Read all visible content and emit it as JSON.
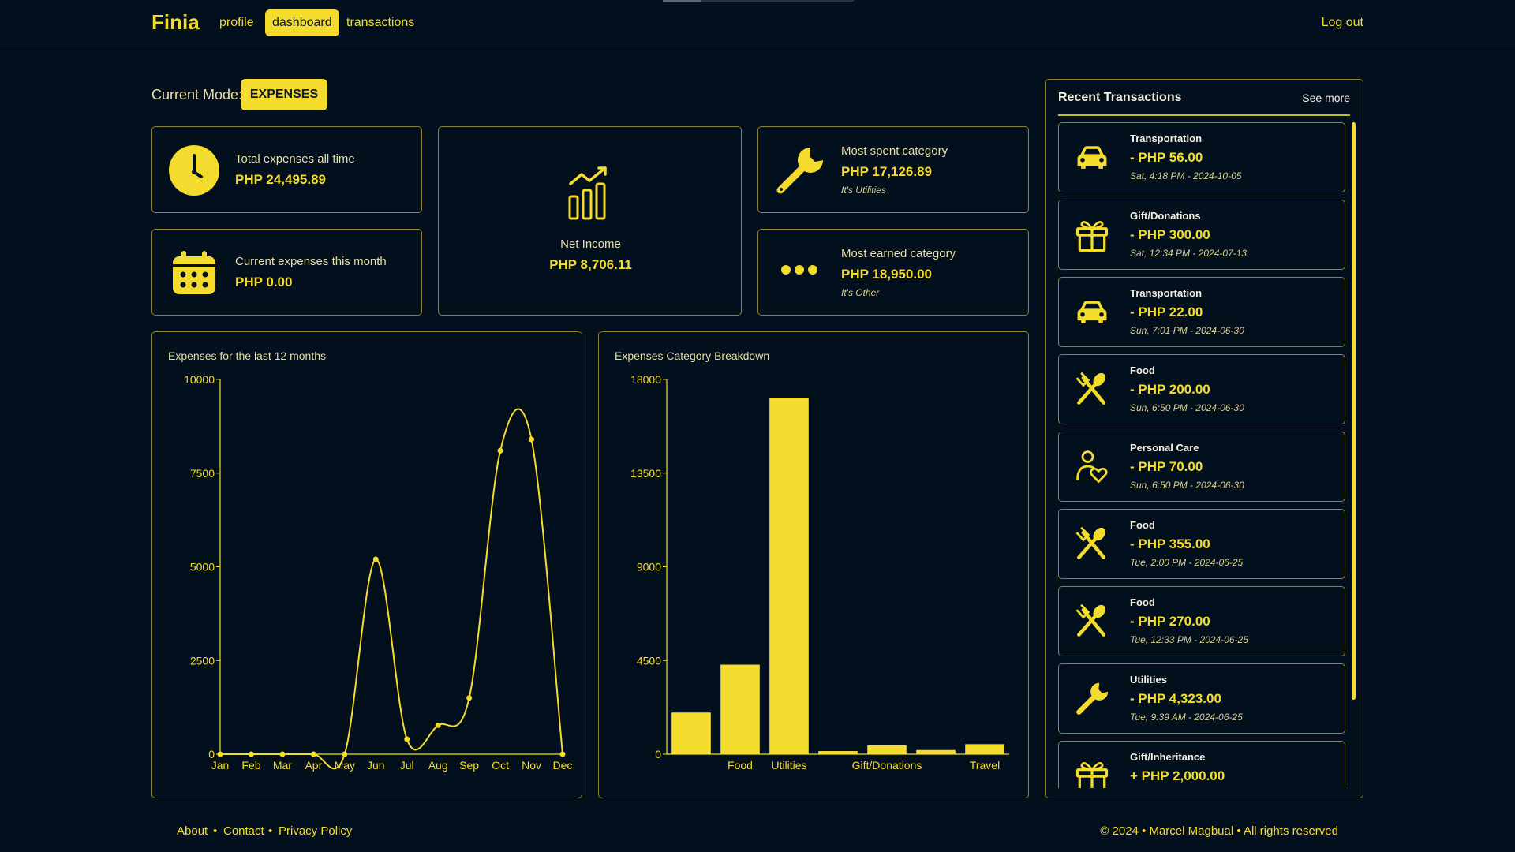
{
  "header": {
    "logo": "Finia",
    "nav": [
      "profile",
      "dashboard",
      "transactions"
    ],
    "active_nav": "dashboard",
    "logout": "Log out"
  },
  "mode": {
    "label": "Current Mode:",
    "value": "EXPENSES"
  },
  "stats": {
    "total": {
      "label": "Total expenses all time",
      "value": "PHP 24,495.89",
      "icon": "clock-icon"
    },
    "month": {
      "label": "Current expenses this month",
      "value": "PHP 0.00",
      "icon": "calendar-icon"
    },
    "net": {
      "label": "Net Income",
      "value": "PHP 8,706.11",
      "icon": "chart-growth-icon"
    },
    "most_spent": {
      "label": "Most spent category",
      "value": "PHP 17,126.89",
      "sub": "It's Utilities",
      "icon": "wrench-icon"
    },
    "most_earned": {
      "label": "Most earned category",
      "value": "PHP 18,950.00",
      "sub": "It's Other",
      "icon": "dots-icon"
    }
  },
  "colors": {
    "accent": "#f3dc2e",
    "background": "#020f1c",
    "border": "#8f8231"
  },
  "recent": {
    "title": "Recent Transactions",
    "see_more": "See more",
    "items": [
      {
        "category": "Transportation",
        "amount": "- PHP 56.00",
        "date": "Sat, 4:18 PM - 2024-10-05",
        "icon": "car-icon"
      },
      {
        "category": "Gift/Donations",
        "amount": "- PHP 300.00",
        "date": "Sat, 12:34 PM - 2024-07-13",
        "icon": "gift-icon"
      },
      {
        "category": "Transportation",
        "amount": "- PHP 22.00",
        "date": "Sun, 7:01 PM - 2024-06-30",
        "icon": "car-icon"
      },
      {
        "category": "Food",
        "amount": "- PHP 200.00",
        "date": "Sun, 6:50 PM - 2024-06-30",
        "icon": "fork-spoon-icon"
      },
      {
        "category": "Personal Care",
        "amount": "- PHP 70.00",
        "date": "Sun, 6:50 PM - 2024-06-30",
        "icon": "person-heart-icon"
      },
      {
        "category": "Food",
        "amount": "- PHP 355.00",
        "date": "Tue, 2:00 PM - 2024-06-25",
        "icon": "fork-spoon-icon"
      },
      {
        "category": "Food",
        "amount": "- PHP 270.00",
        "date": "Tue, 12:33 PM - 2024-06-25",
        "icon": "fork-spoon-icon"
      },
      {
        "category": "Utilities",
        "amount": "- PHP 4,323.00",
        "date": "Tue, 9:39 AM - 2024-06-25",
        "icon": "wrench-icon"
      },
      {
        "category": "Gift/Inheritance",
        "amount": "+ PHP 2,000.00",
        "date": "",
        "icon": "gift-icon"
      }
    ]
  },
  "footer": {
    "links": [
      "About",
      "Contact",
      "Privacy Policy"
    ],
    "copyright": "© 2024 • Marcel Magbual • All rights reserved"
  },
  "chart_data": [
    {
      "type": "line",
      "title": "Expenses for the last 12 months",
      "categories": [
        "Jan",
        "Feb",
        "Mar",
        "Apr",
        "May",
        "Jun",
        "Jul",
        "Aug",
        "Sep",
        "Oct",
        "Nov",
        "Dec"
      ],
      "values": [
        0,
        0,
        0,
        0,
        0,
        5200,
        400,
        770,
        1500,
        8100,
        8400,
        0
      ],
      "yticks": [
        "0",
        "2500",
        "5000",
        "7500",
        "10000"
      ],
      "ylim": [
        0,
        10000
      ],
      "grid": false
    },
    {
      "type": "bar",
      "title": "Expenses Category Breakdown",
      "categories": [
        "",
        "Food",
        "Utilities",
        "",
        "Gift/Donations",
        "",
        "Travel"
      ],
      "values": [
        2000,
        4300,
        17126.89,
        150,
        420,
        200,
        480
      ],
      "yticks": [
        "0",
        "4500",
        "9000",
        "13500",
        "18000"
      ],
      "ylim": [
        0,
        18000
      ],
      "grid": false
    }
  ]
}
